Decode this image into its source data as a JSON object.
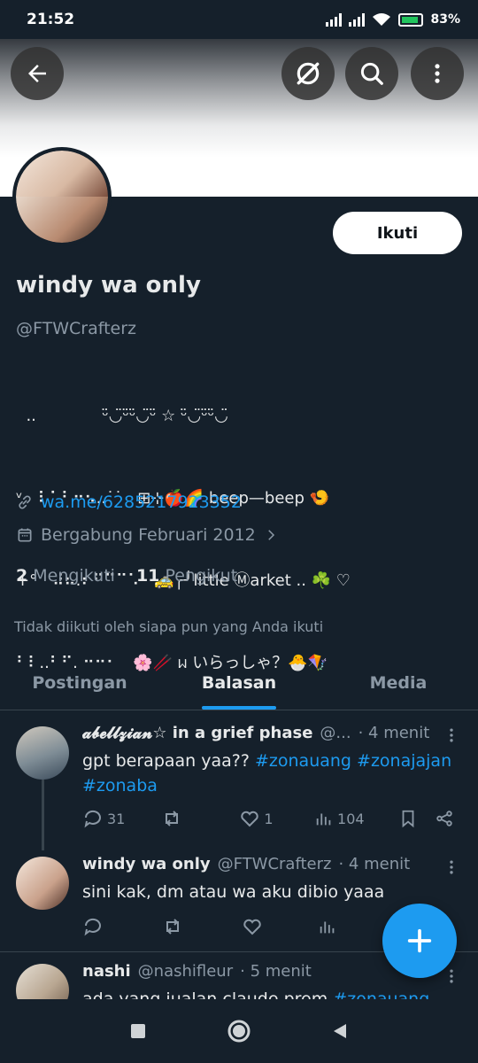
{
  "status_bar": {
    "time": "21:52",
    "battery": "83%"
  },
  "profile": {
    "name": "windy wa only",
    "handle": "@FTWCrafterz",
    "bio_lines": [
      "  ..             ᵕ̈◡̈ᵕ̈ᵕ̈◡̈ᵕ̈ ☆ ᵕ̈◡̈ᵕ̈ᵕ̈◡̈",
      "ᵛ   ⠇⠁⠃⠒⠢..˙˙   ⊞⊹🍎🌈 beep—beep 🍤",
      "+°   ⠼⠦.⠆⠋⠉⠉⠡   🚕╭╯little Ⓜarket .. ☘️ ♡",
      "⠃⠇..⠃⠋. ⠒⠒⠂   🌸🥢 ᥕ いらっしゃ？🐣🪁"
    ],
    "link": "wa.me/6285217923352",
    "joined": "Bergabung Februari 2012",
    "following_count": "2",
    "following_label": "Mengikuti",
    "followers_count": "11",
    "followers_label": "Pengikut",
    "not_followed": "Tidak diikuti oleh siapa pun yang Anda ikuti",
    "follow_button": "Ikuti"
  },
  "tabs": [
    {
      "label": "Postingan",
      "active": false
    },
    {
      "label": "Balasan",
      "active": true
    },
    {
      "label": "Media",
      "active": false
    }
  ],
  "posts": [
    {
      "name": "𝓪𝓫𝓮𝓵𝓵𝔃𝓲𝓪𝓷☆ 𝗶𝗻 𝗮 𝗴𝗿𝗶𝗲𝗳 𝗽𝗵𝗮𝘀𝗲",
      "handle": "@...",
      "time": "· 4 menit",
      "text": "gpt berapaan yaa??",
      "tags": "#zonauang #zonajajan #zonaba",
      "replies": "31",
      "retweets": "",
      "likes": "1",
      "views": "104"
    },
    {
      "name": "windy wa only",
      "handle": "@FTWCrafterz",
      "time": "· 4 menit",
      "text": "sini kak, dm atau wa aku dibio yaaa"
    },
    {
      "name": "nashi",
      "handle": "@nashifleur",
      "time": "· 5 menit",
      "text": "ada yang jualan claude prem",
      "tags": "#zonauang"
    }
  ],
  "icons": {
    "back": "arrow-left-icon",
    "grok": "grok-icon",
    "search": "search-icon",
    "more": "more-vertical-icon",
    "fab": "plus-icon"
  },
  "colors": {
    "background": "#15202b",
    "accent": "#1d9bf0"
  }
}
